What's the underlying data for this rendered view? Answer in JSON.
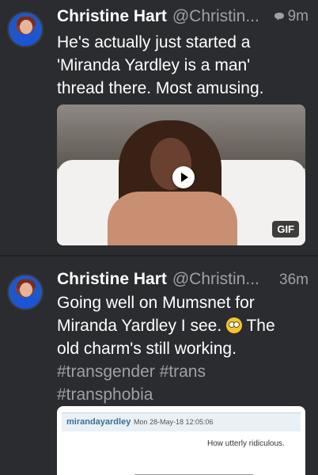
{
  "tweets": [
    {
      "name": "Christine Hart",
      "handle": "@Christin...",
      "time": "9m",
      "has_reply_icon": true,
      "text_lines": [
        "He's actually just started a",
        "'Miranda Yardley is a man'",
        "thread there. Most amusing."
      ],
      "media": {
        "badge": "GIF"
      }
    },
    {
      "name": "Christine Hart",
      "handle": "@Christin...",
      "time": "36m",
      "text_lines": [
        "Going well on Mumsnet for",
        "Miranda Yardley I see.",
        "The",
        "old charm's still working."
      ],
      "hashtags_line1": "#transgender #trans",
      "hashtags_line2": "#transphobia",
      "emoji": "face-with-rolling-eyes-icon",
      "quote": {
        "username": "mirandayardley",
        "date": "Mon 28-May-18 12:05:06",
        "body": "How utterly ridiculous."
      }
    }
  ],
  "colors": {
    "background": "#2b2c30",
    "text": "#ffffff",
    "muted": "#9ea0a6"
  }
}
